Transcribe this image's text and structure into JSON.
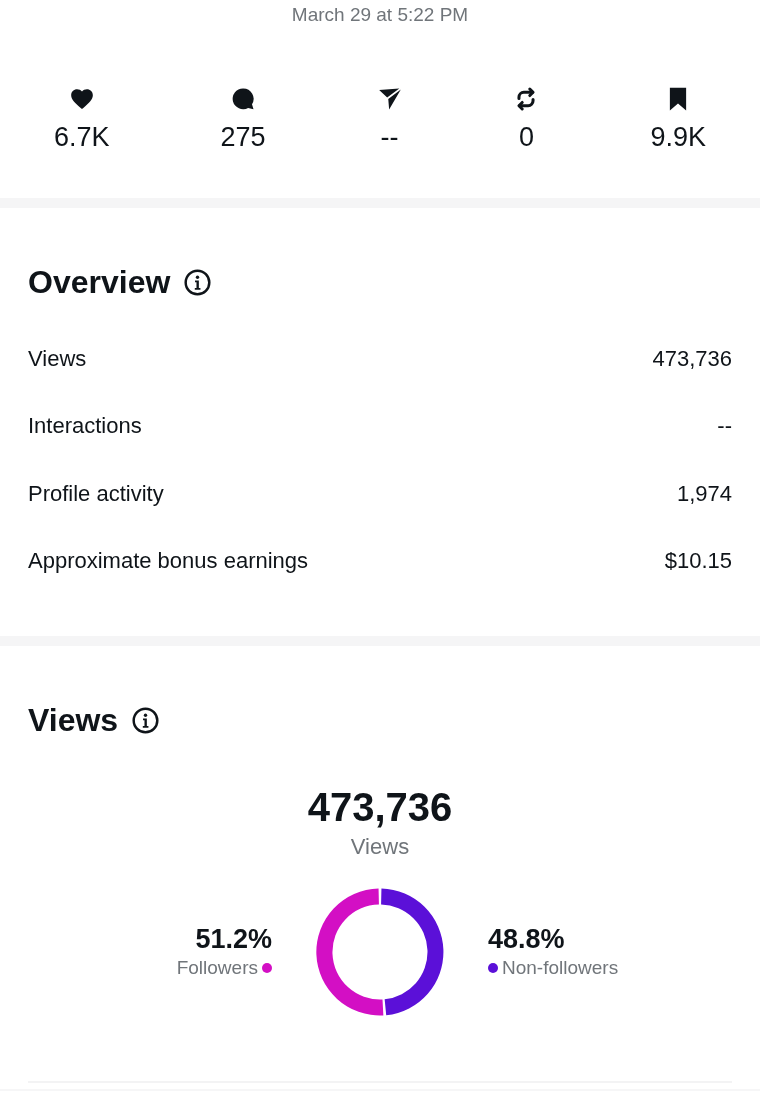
{
  "timestamp": "March 29 at 5:22 PM",
  "stats": [
    {
      "kind": "likes",
      "value": "6.7K"
    },
    {
      "kind": "comments",
      "value": "275"
    },
    {
      "kind": "shares",
      "value": "--"
    },
    {
      "kind": "reposts",
      "value": "0"
    },
    {
      "kind": "saves",
      "value": "9.9K"
    }
  ],
  "overview": {
    "title": "Overview",
    "rows": [
      {
        "label": "Views",
        "value": "473,736"
      },
      {
        "label": "Interactions",
        "value": "--"
      },
      {
        "label": "Profile activity",
        "value": "1,974"
      },
      {
        "label": "Approximate bonus earnings",
        "value": "$10.15"
      }
    ]
  },
  "views": {
    "title": "Views",
    "total": "473,736",
    "total_label": "Views",
    "legend": [
      {
        "color": "#d30fc4"
      },
      {
        "color": "#5b10d8"
      }
    ],
    "chart_data": {
      "type": "donut",
      "categories": [
        "Followers",
        "Non-followers"
      ],
      "values": [
        51.2,
        48.8
      ],
      "value_labels": [
        "51.2%",
        "48.8%"
      ]
    }
  }
}
